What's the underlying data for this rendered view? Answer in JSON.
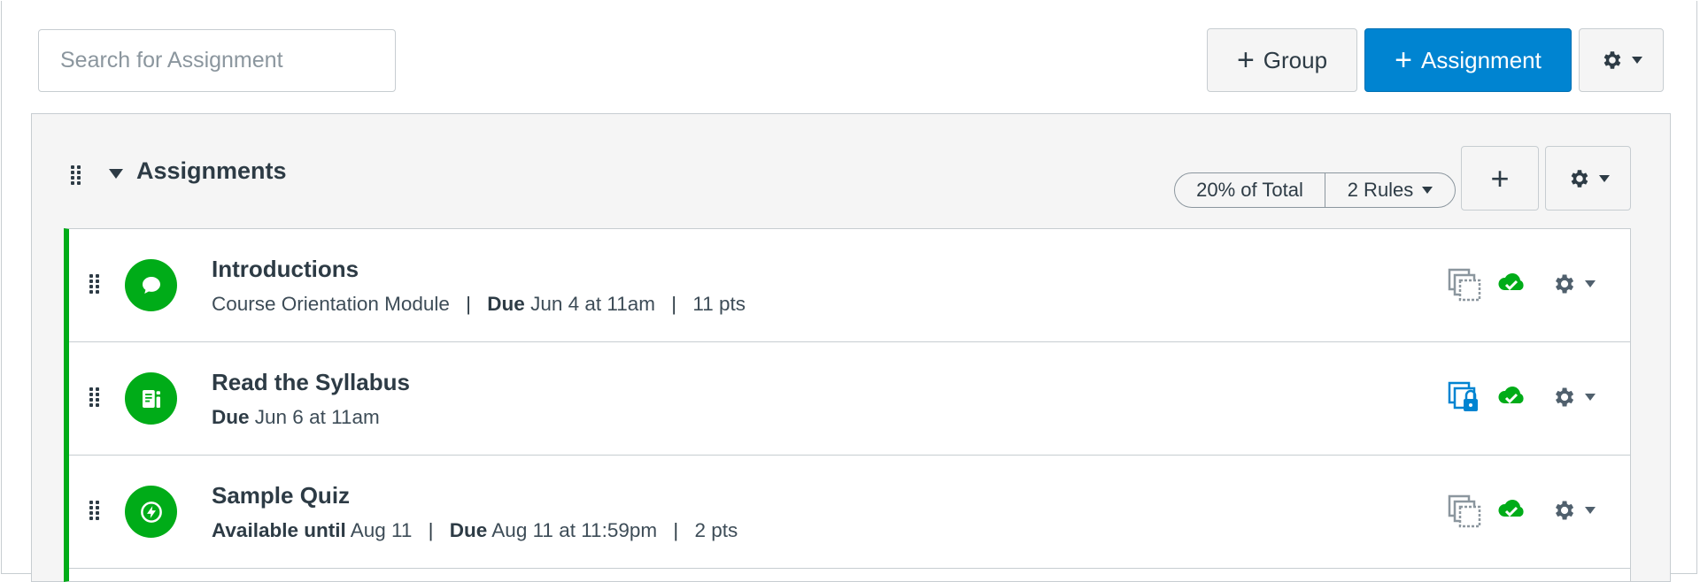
{
  "search": {
    "placeholder": "Search for Assignment"
  },
  "toolbar": {
    "group_label": "Group",
    "assignment_label": "Assignment",
    "plus": "+",
    "gear_icon": "gear-icon",
    "accent": "#0084d1"
  },
  "group": {
    "title": "Assignments",
    "weight": "20% of Total",
    "rules": "2 Rules",
    "add_label": "+",
    "status_color": "#00ac18"
  },
  "assignments": [
    {
      "title": "Introductions",
      "icon": "discussion-icon",
      "module": "Course Orientation Module",
      "due_label": "Due",
      "due_value": "Jun 4 at 11am",
      "points": "11 pts",
      "duplicate_locked": false,
      "published": true
    },
    {
      "title": "Read the Syllabus",
      "icon": "page-icon",
      "due_label": "Due",
      "due_value": "Jun 6 at 11am",
      "duplicate_locked": true,
      "published": true
    },
    {
      "title": "Sample Quiz",
      "icon": "quiz-icon",
      "avail_label": "Available until",
      "avail_value": "Aug 11",
      "due_label": "Due",
      "due_value": "Aug 11 at 11:59pm",
      "points": "2 pts",
      "duplicate_locked": false,
      "published": true
    }
  ],
  "separator": "|"
}
